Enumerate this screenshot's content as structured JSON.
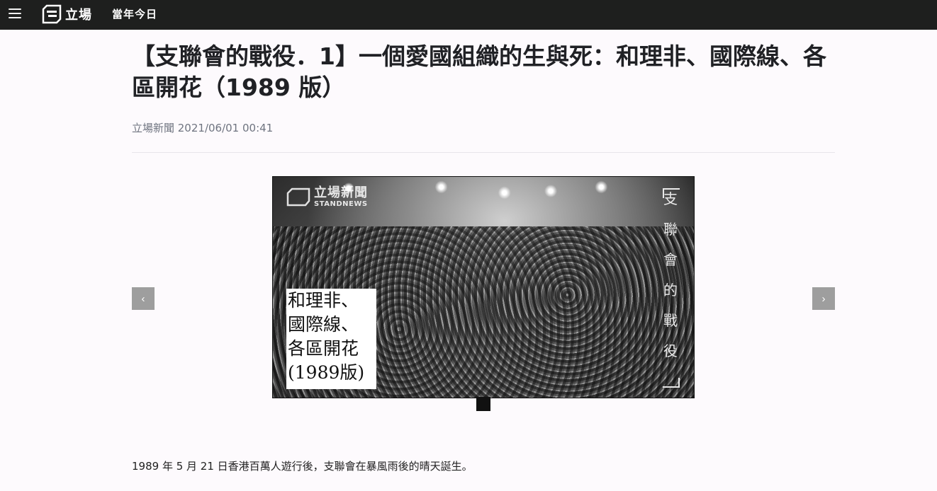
{
  "header": {
    "logo_text": "立場",
    "nav_link": "當年今日"
  },
  "article": {
    "title": "【支聯會的戰役．1】一個愛國組織的生與死：和理非、國際線、各區開花（1989 版）",
    "byline": "立場新聞 2021/06/01 00:41",
    "paragraph": "1989 年 5 月 21 日香港百萬人遊行後，支聯會在暴風雨後的晴天誕生。"
  },
  "carousel": {
    "prev_label": "‹",
    "next_label": "›",
    "image": {
      "watermark_cn": "立場新聞",
      "watermark_en": "STANDNEWS",
      "overlay_lines": [
        "和理非、",
        "國際線、",
        "各區開花",
        "(1989版)"
      ],
      "vertical_title": [
        "支",
        "聯",
        "會",
        "的",
        "戰",
        "役"
      ]
    }
  },
  "colors": {
    "topbar": "#1e1f1e",
    "background": "#fdfafd",
    "nav_button": "#9e9e9e"
  }
}
